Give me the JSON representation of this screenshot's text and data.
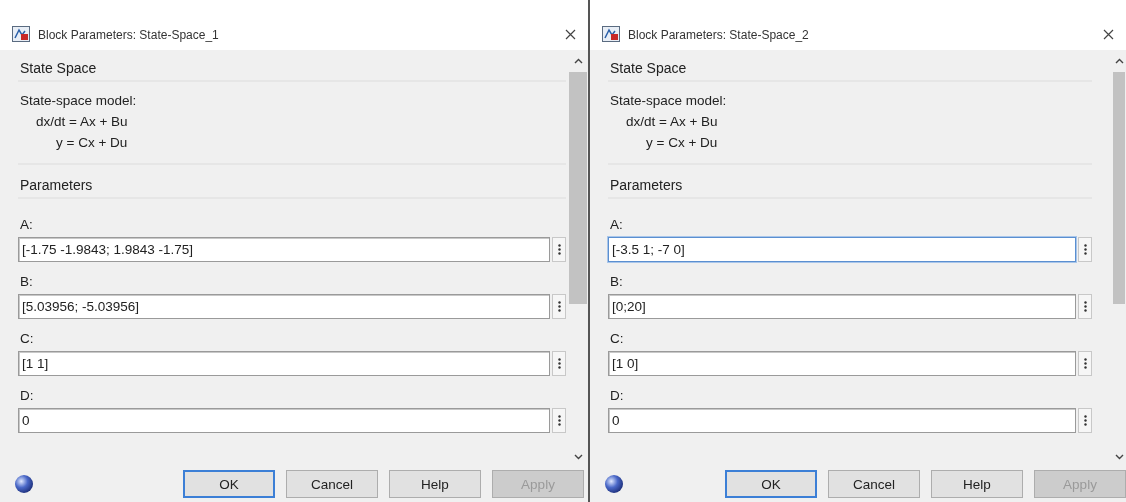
{
  "dialogs": [
    {
      "title": "Block Parameters: State-Space_1",
      "section": "State Space",
      "description": [
        "State-space model:",
        "dx/dt = Ax + Bu",
        "y = Cx + Du"
      ],
      "parameters_header": "Parameters",
      "parameters": [
        {
          "label": "A:",
          "value": "[-1.75 -1.9843; 1.9843 -1.75]",
          "focused": false
        },
        {
          "label": "B:",
          "value": "[5.03956; -5.03956]",
          "focused": false
        },
        {
          "label": "C:",
          "value": "[1 1]",
          "focused": false
        },
        {
          "label": "D:",
          "value": "0",
          "focused": false
        }
      ],
      "buttons": [
        {
          "label": "OK",
          "default": true,
          "disabled": false
        },
        {
          "label": "Cancel",
          "default": false,
          "disabled": false
        },
        {
          "label": "Help",
          "default": false,
          "disabled": false
        },
        {
          "label": "Apply",
          "default": false,
          "disabled": true
        }
      ]
    },
    {
      "title": "Block Parameters: State-Space_2",
      "section": "State Space",
      "description": [
        "State-space model:",
        "dx/dt = Ax + Bu",
        "y = Cx + Du"
      ],
      "parameters_header": "Parameters",
      "parameters": [
        {
          "label": "A:",
          "value": "[-3.5 1; -7 0]",
          "focused": true
        },
        {
          "label": "B:",
          "value": "[0;20]",
          "focused": false
        },
        {
          "label": "C:",
          "value": "[1 0]",
          "focused": false
        },
        {
          "label": "D:",
          "value": "0",
          "focused": false
        }
      ],
      "buttons": [
        {
          "label": "OK",
          "default": true,
          "disabled": false
        },
        {
          "label": "Cancel",
          "default": false,
          "disabled": false
        },
        {
          "label": "Help",
          "default": false,
          "disabled": false
        },
        {
          "label": "Apply",
          "default": false,
          "disabled": true
        }
      ]
    }
  ]
}
